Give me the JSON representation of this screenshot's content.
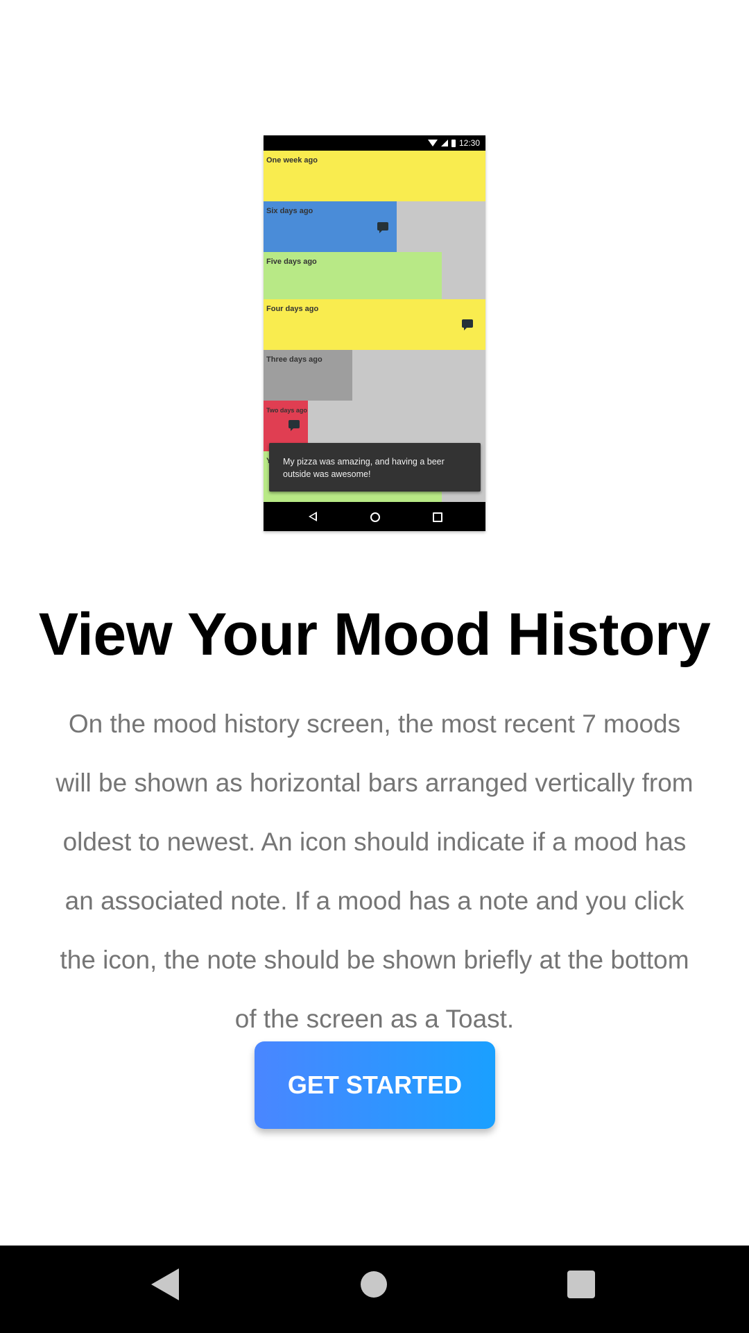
{
  "mockup": {
    "status_time": "12:30",
    "bars": [
      {
        "label": "One week ago",
        "color": "#f9ec4f",
        "has_note": false
      },
      {
        "label": "Six days ago",
        "color": "#4a8cd8",
        "has_note": true
      },
      {
        "label": "Five days ago",
        "color": "#b8e986",
        "has_note": false
      },
      {
        "label": "Four days ago",
        "color": "#f9ec4f",
        "has_note": true
      },
      {
        "label": "Three days ago",
        "color": "#9e9e9e",
        "has_note": false
      },
      {
        "label": "Two days ago",
        "color": "#e03e52",
        "has_note": true
      },
      {
        "label": "Yesterday",
        "color": "#b8e986",
        "has_note": false
      }
    ],
    "toast_text": "My pizza was amazing, and having a beer outside was awesome!"
  },
  "title": "View Your Mood History",
  "description": "On the mood history screen, the most recent 7 moods will be shown as horizontal bars arranged vertically from oldest to newest. An icon should indicate if a mood has an associated note. If a mood has a note and you click the icon, the note should be shown briefly at the bottom of the screen as a Toast.",
  "cta_label": "GET STARTED",
  "colors": {
    "button_gradient_start": "#4a86ff",
    "button_gradient_end": "#1aa0ff",
    "description_text": "#757575"
  },
  "system_nav": {
    "back": "back-icon",
    "home": "home-icon",
    "recents": "recents-icon"
  }
}
